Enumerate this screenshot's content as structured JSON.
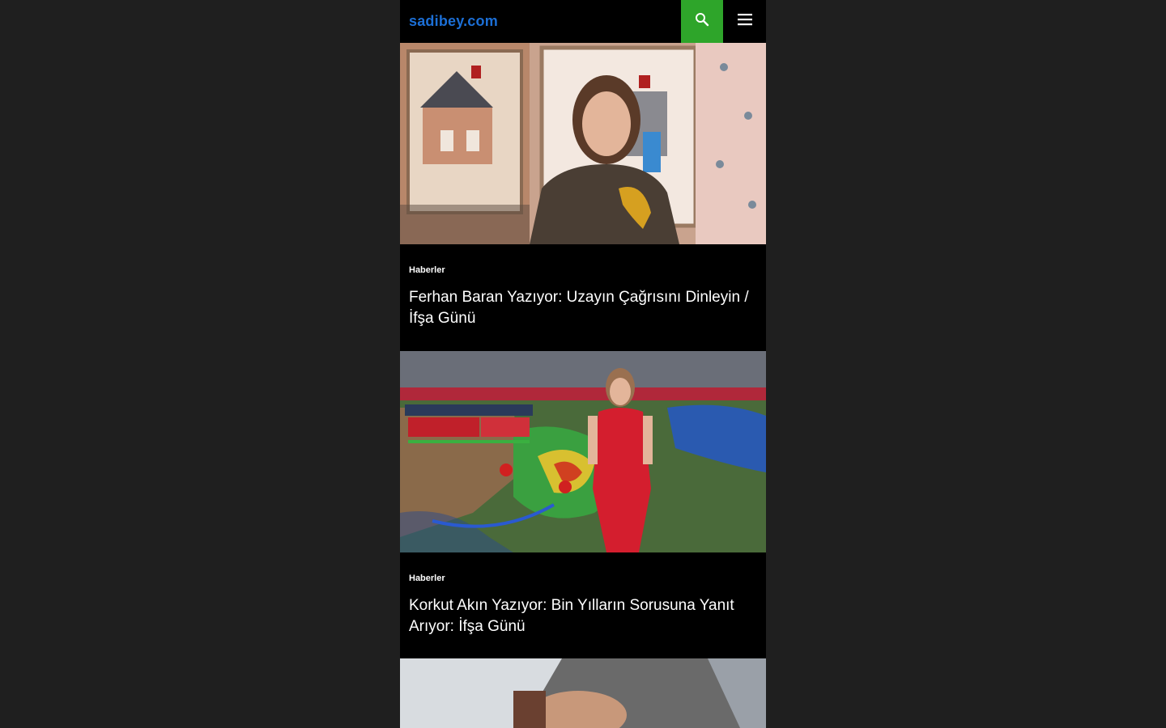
{
  "header": {
    "logo": "sadibey.com",
    "search_icon": "search-icon",
    "menu_icon": "hamburger-menu-icon"
  },
  "colors": {
    "brand_blue": "#1c6fd6",
    "search_green": "#2ea52a",
    "background": "#000000",
    "page_outer": "#1f1f1f"
  },
  "articles": [
    {
      "category": "Haberler",
      "title": "Ferhan Baran Yazıyor: Uzayın Çağrısını Dinleyin / İfşa Günü"
    },
    {
      "category": "Haberler",
      "title": "Korkut Akın Yazıyor: Bin Yılların Sorusuna Yanıt Arıyor: İfşa Günü"
    }
  ]
}
